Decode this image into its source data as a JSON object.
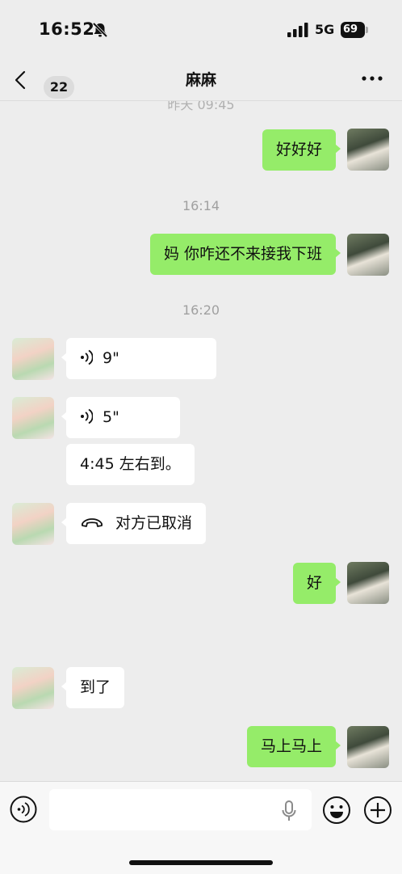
{
  "status_bar": {
    "time": "16:52",
    "network": "5G",
    "battery": "69",
    "icons": [
      "bell-slash-icon",
      "signal-icon"
    ]
  },
  "header": {
    "unread_count": "22",
    "title": "麻麻",
    "back_icon": "chevron-left-icon",
    "more_icon": "more-dots-icon"
  },
  "chat": {
    "timestamp_partial": "昨天 09:45",
    "timestamp_1": "16:14",
    "timestamp_2": "16:20",
    "msg_1": "好好好",
    "msg_2": "妈 你咋还不来接我下班",
    "voice_1": "9\"",
    "voice_2": "5\"",
    "msg_3": "4:45 左右到。",
    "call_cancelled": "对方已取消",
    "msg_4": "好",
    "msg_5": "到了",
    "msg_6": "马上马上"
  },
  "colors": {
    "background": "#ededed",
    "my_bubble": "#95ec69",
    "other_bubble": "#ffffff",
    "timestamp": "#a0a0a0"
  },
  "input_bar": {
    "icons": [
      "voice-input-icon",
      "microphone-icon",
      "emoji-icon",
      "plus-icon"
    ]
  }
}
